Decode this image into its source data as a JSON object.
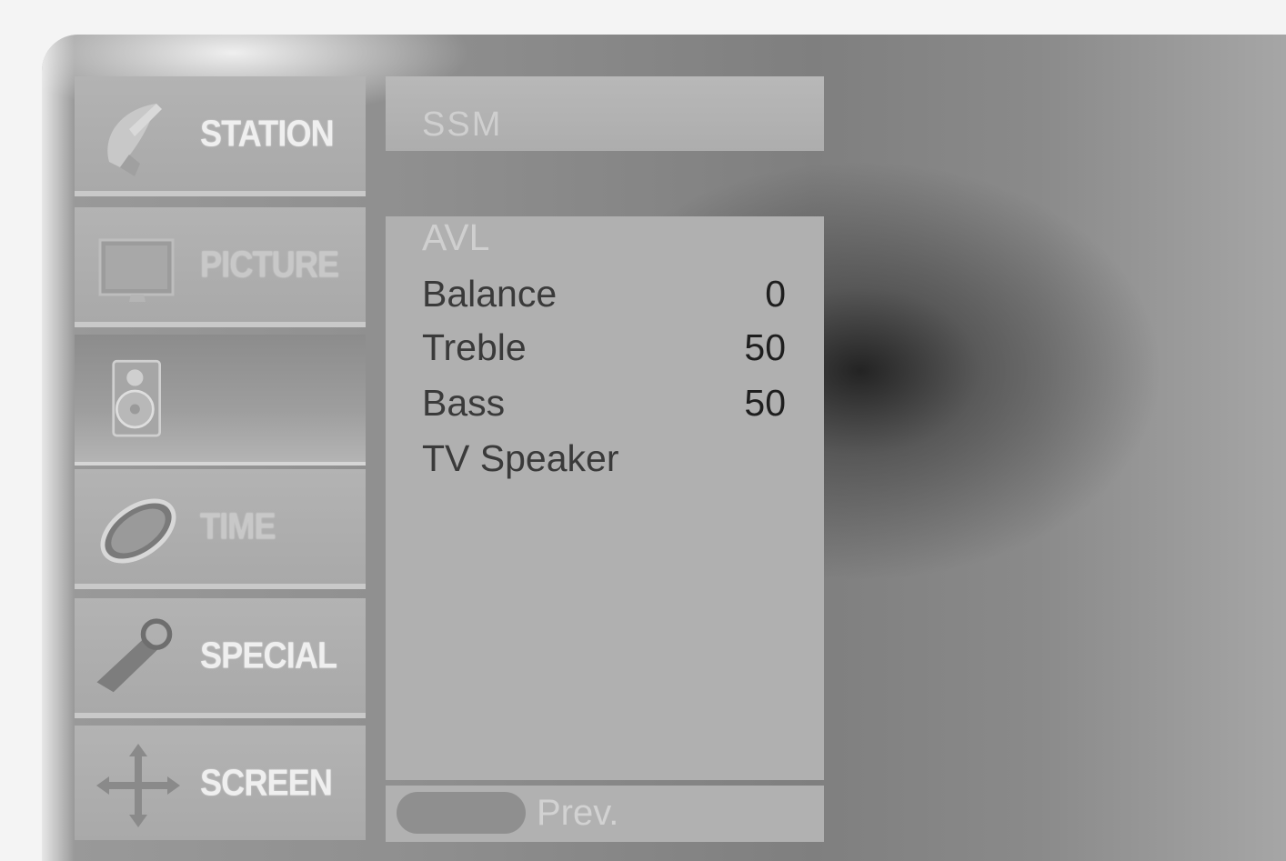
{
  "menu": {
    "tabs": [
      {
        "id": "station",
        "label": "STATION",
        "icon": "satellite-dish-icon",
        "active": false
      },
      {
        "id": "picture",
        "label": "PICTURE",
        "icon": "tv-screen-icon",
        "active": false
      },
      {
        "id": "sound",
        "label": "",
        "icon": "speaker-icon",
        "active": true
      },
      {
        "id": "time",
        "label": "TIME",
        "icon": "clock-icon",
        "active": false
      },
      {
        "id": "special",
        "label": "SPECIAL",
        "icon": "tag-key-icon",
        "active": false
      },
      {
        "id": "screen",
        "label": "SCREEN",
        "icon": "move-arrows-icon",
        "active": false
      }
    ]
  },
  "submenu": {
    "header": "SSM",
    "items": [
      {
        "label": "AVL",
        "value": ""
      },
      {
        "label": "Balance",
        "value": "0"
      },
      {
        "label": "Treble",
        "value": "50"
      },
      {
        "label": "Bass",
        "value": "50"
      },
      {
        "label": "TV Speaker",
        "value": ""
      }
    ]
  },
  "footer": {
    "prev_label": "Prev."
  }
}
